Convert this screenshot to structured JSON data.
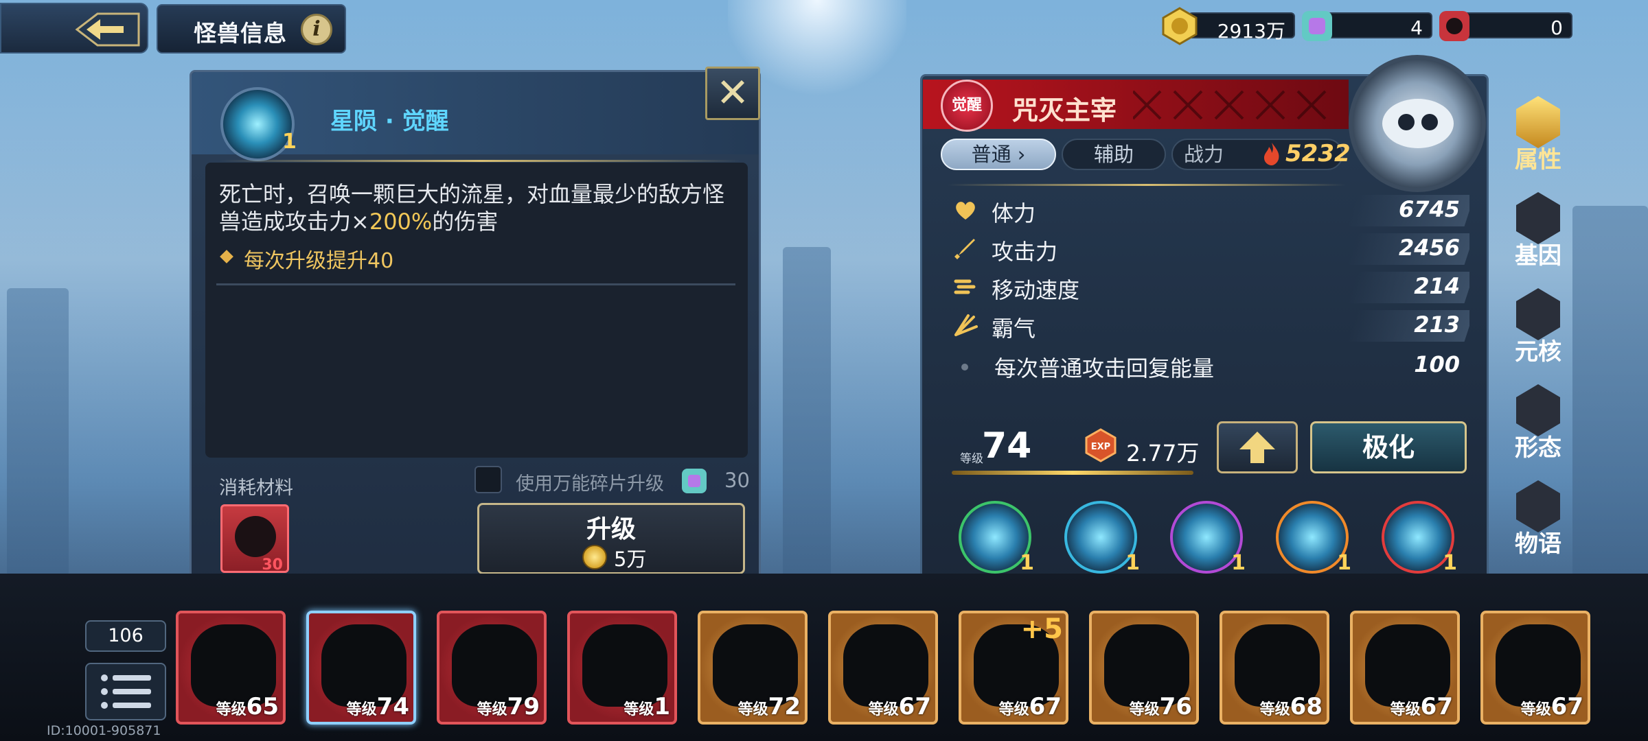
{
  "header": {
    "title": "怪兽信息",
    "info_glyph": "i",
    "resources": [
      {
        "icon": "gold-coin-icon",
        "value": "2913万"
      },
      {
        "icon": "universal-fragment-icon",
        "value": "4"
      },
      {
        "icon": "monster-fragment-icon",
        "value": "0"
      }
    ]
  },
  "skill_panel": {
    "skill_name": "星陨 · 觉醒",
    "skill_level": "1",
    "description_a": "死亡时，召唤一颗巨大的流星，对血量最少的敌方怪兽造成攻击力×",
    "description_pct": "200%",
    "description_b": "的伤害",
    "upgrade_note": "每次升级提升40",
    "materials_label": "消耗材料",
    "use_universal_label": "使用万能碎片升级",
    "universal_needed": "30",
    "material_count": "30",
    "upgrade_button": "升级",
    "upgrade_cost": "5万",
    "close_glyph": "✕"
  },
  "monster": {
    "awake_badge": "觉醒",
    "name": "咒灭主宰",
    "tabs": {
      "normal": "普通",
      "assist": "辅助",
      "power_label": "战力"
    },
    "power": "5232",
    "stats": [
      {
        "icon": "heart-icon",
        "label": "体力",
        "value": "6745"
      },
      {
        "icon": "sword-icon",
        "label": "攻击力",
        "value": "2456"
      },
      {
        "icon": "speed-icon",
        "label": "移动速度",
        "value": "214"
      },
      {
        "icon": "aura-icon",
        "label": "霸气",
        "value": "213"
      },
      {
        "icon": "dot-icon",
        "label": "每次普通攻击回复能量",
        "value": "100"
      }
    ],
    "level_label": "等级",
    "level": "74",
    "exp_badge": "EXP",
    "exp": "2.77万",
    "polarize_button": "极化",
    "skills": [
      {
        "level": "1",
        "gem": "#3cc46a"
      },
      {
        "level": "1",
        "gem": "#38b8e0"
      },
      {
        "level": "1",
        "gem": "#b24ad6"
      },
      {
        "level": "1",
        "gem": "#f08a2a"
      },
      {
        "level": "1",
        "gem": "#e23c3c"
      }
    ]
  },
  "side_tabs": [
    {
      "label": "属性",
      "active": true
    },
    {
      "label": "基因",
      "active": false
    },
    {
      "label": "元核",
      "active": false
    },
    {
      "label": "形态",
      "active": false
    },
    {
      "label": "物语",
      "active": false
    }
  ],
  "roster": {
    "count": "106",
    "uid": "ID:10001-905871",
    "level_prefix": "等级",
    "cards": [
      {
        "level": "65",
        "style": "red"
      },
      {
        "level": "74",
        "style": "red",
        "selected": true
      },
      {
        "level": "79",
        "style": "red"
      },
      {
        "level": "1",
        "style": "red"
      },
      {
        "level": "72",
        "style": "gold"
      },
      {
        "level": "67",
        "style": "gold"
      },
      {
        "level": "67",
        "style": "gold",
        "plus": "+5"
      },
      {
        "level": "76",
        "style": "gold"
      },
      {
        "level": "68",
        "style": "gold"
      },
      {
        "level": "67",
        "style": "gold"
      },
      {
        "level": "67",
        "style": "gold"
      }
    ]
  },
  "colors": {
    "accent_gold": "#ffd35a",
    "skill_blue": "#5fd6ff",
    "banner_red": "#b8141e"
  }
}
